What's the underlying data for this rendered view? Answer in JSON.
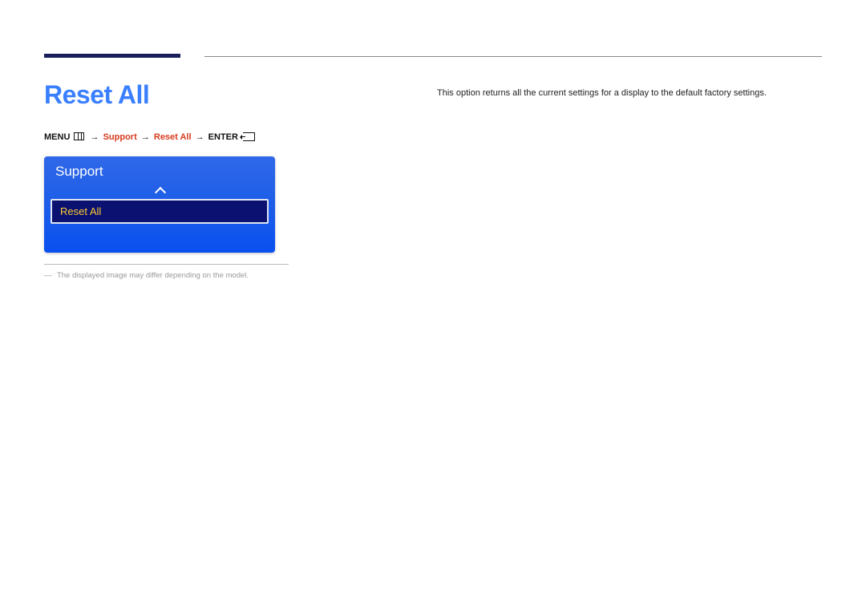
{
  "page": {
    "title": "Reset All"
  },
  "breadcrumb": {
    "menu_label": "MENU",
    "segments": [
      "Support",
      "Reset All"
    ],
    "enter_label": "ENTER"
  },
  "osd": {
    "header": "Support",
    "selected_item": "Reset All"
  },
  "note": {
    "text": "The displayed image may differ depending on the model."
  },
  "description": {
    "text": "This option returns all the current settings for a display to the default factory settings."
  }
}
